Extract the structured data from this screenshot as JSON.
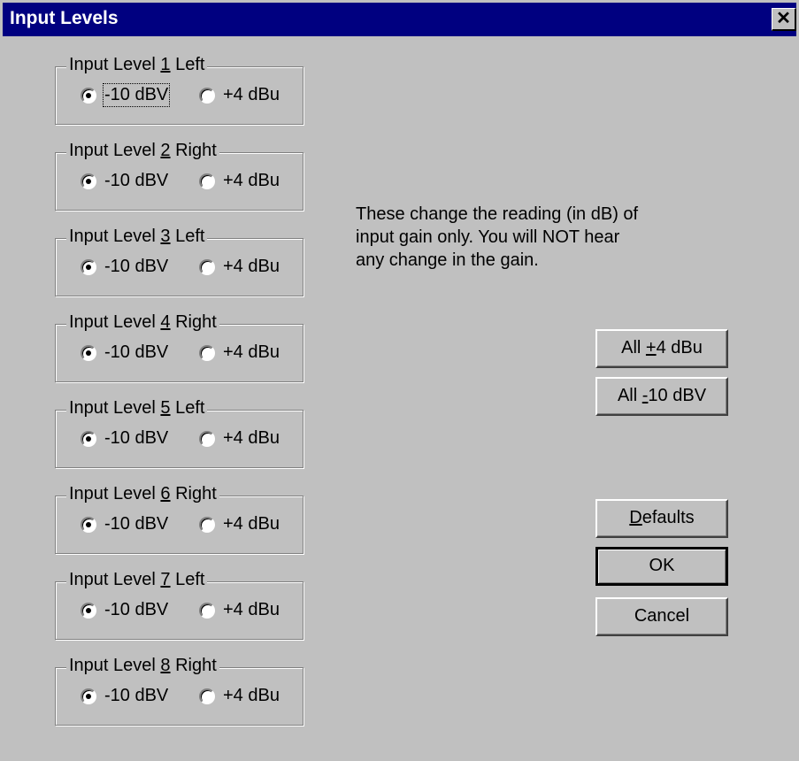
{
  "window": {
    "title": "Input Levels",
    "close_glyph": "✕"
  },
  "groups": [
    {
      "prefix": "Input Level ",
      "key": "1",
      "suffix": " Left",
      "option1": "-10 dBV",
      "option2": "+4 dBu",
      "selected": 1
    },
    {
      "prefix": "Input Level ",
      "key": "2",
      "suffix": " Right",
      "option1": "-10 dBV",
      "option2": "+4 dBu",
      "selected": 1
    },
    {
      "prefix": "Input Level ",
      "key": "3",
      "suffix": " Left",
      "option1": "-10 dBV",
      "option2": "+4 dBu",
      "selected": 1
    },
    {
      "prefix": "Input Level ",
      "key": "4",
      "suffix": " Right",
      "option1": "-10 dBV",
      "option2": "+4 dBu",
      "selected": 1
    },
    {
      "prefix": "Input Level ",
      "key": "5",
      "suffix": " Left",
      "option1": "-10 dBV",
      "option2": "+4 dBu",
      "selected": 1
    },
    {
      "prefix": "Input Level ",
      "key": "6",
      "suffix": " Right",
      "option1": "-10 dBV",
      "option2": "+4 dBu",
      "selected": 1
    },
    {
      "prefix": "Input Level ",
      "key": "7",
      "suffix": " Left",
      "option1": "-10 dBV",
      "option2": "+4 dBu",
      "selected": 1
    },
    {
      "prefix": "Input Level ",
      "key": "8",
      "suffix": " Right",
      "option1": "-10 dBV",
      "option2": "+4 dBu",
      "selected": 1
    }
  ],
  "note": {
    "line1": "These change the reading (in dB) of",
    "line2": "input gain only.  You will NOT hear",
    "line3": "any change in the gain."
  },
  "buttons": {
    "all_plus4": {
      "pre": "All ",
      "key": "+",
      "post": "4 dBu"
    },
    "all_minus10": {
      "pre": "All ",
      "key": "-",
      "post": "10 dBV"
    },
    "defaults": {
      "pre": "",
      "key": "D",
      "post": "efaults"
    },
    "ok": "OK",
    "cancel": "Cancel"
  }
}
